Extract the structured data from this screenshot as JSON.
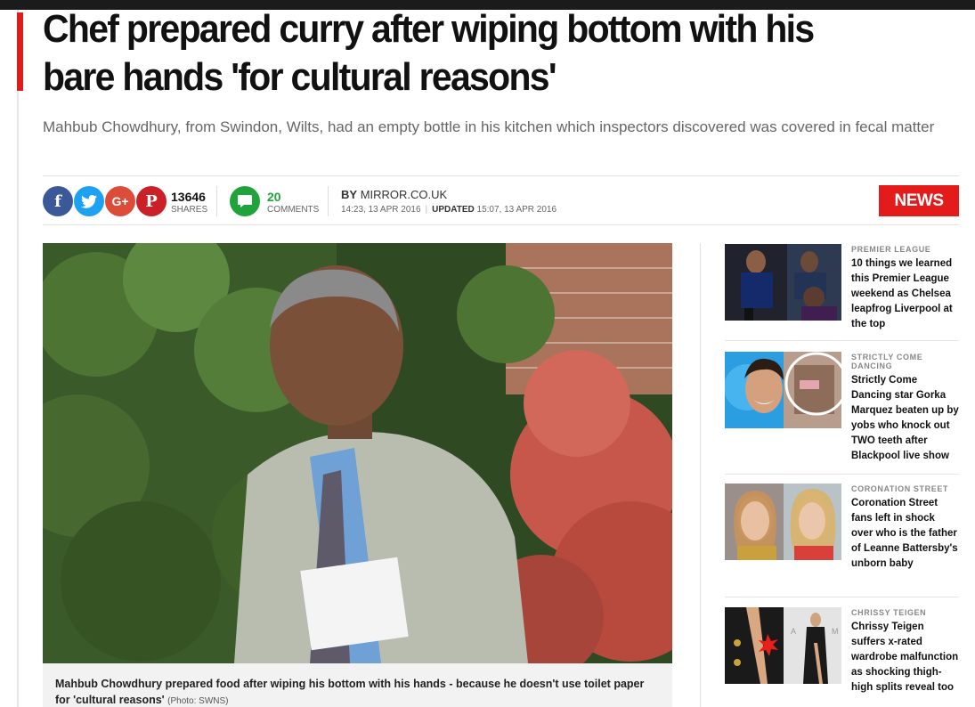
{
  "article": {
    "headline": "Chef prepared curry after wiping bottom with his bare hands 'for cultural reasons'",
    "standfirst": "Mahbub Chowdhury, from Swindon, Wilts, had an empty bottle in his kitchen which inspectors discovered was covered in fecal matter",
    "share_count": "13646",
    "share_label": "SHARES",
    "comment_count": "20",
    "comment_label": "COMMENTS",
    "by_prefix": "BY",
    "author": "MIRROR.CO.UK",
    "published": "14:23, 13 APR 2016",
    "updated_label": "UPDATED",
    "updated": "15:07, 13 APR 2016",
    "section_badge": "NEWS",
    "caption": "Mahbub Chowdhury prepared food after wiping his bottom with his hands - because he doesn't use toilet paper for 'cultural reasons'",
    "caption_credit": "(Photo: SWNS)"
  },
  "social": {
    "facebook": "f",
    "twitter": "twitter-icon",
    "googleplus": "G+",
    "pinterest": "P",
    "comment_icon": "comment-bubble-icon"
  },
  "sidebar": {
    "items": [
      {
        "category": "PREMIER LEAGUE",
        "title": "10 things we learned this Premier League weekend as Chelsea leapfrog Liverpool at the top"
      },
      {
        "category": "STRICTLY COME DANCING",
        "title": "Strictly Come Dancing star Gorka Marquez beaten up by yobs who knock out TWO teeth after Blackpool live show"
      },
      {
        "category": "CORONATION STREET",
        "title": "Coronation Street fans left in shock over who is the father of Leanne Battersby's unborn baby"
      },
      {
        "category": "CHRISSY TEIGEN",
        "title": "Chrissy Teigen suffers x-rated wardrobe malfunction as shocking thigh-high splits reveal too"
      }
    ]
  },
  "colors": {
    "accent": "#e41b1b",
    "facebook": "#3b5998",
    "twitter": "#1da1f2",
    "googleplus": "#dd4b39",
    "pinterest": "#cb2027",
    "comments": "#21a33b"
  }
}
